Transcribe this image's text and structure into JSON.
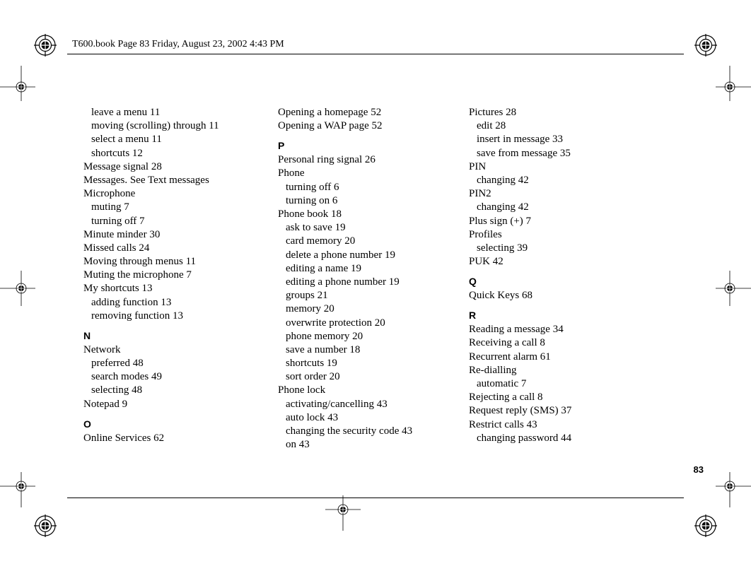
{
  "header": "T600.book  Page 83  Friday, August 23, 2002  4:43 PM",
  "page_number": "83",
  "col1": [
    {
      "t": "sub",
      "text": "leave a menu 11"
    },
    {
      "t": "sub",
      "text": "moving (scrolling) through 11"
    },
    {
      "t": "sub",
      "text": "select a menu 11"
    },
    {
      "t": "sub",
      "text": "shortcuts 12"
    },
    {
      "t": "entry",
      "text": "Message signal 28"
    },
    {
      "t": "entry",
      "text": "Messages. See Text messages"
    },
    {
      "t": "entry",
      "text": "Microphone"
    },
    {
      "t": "sub",
      "text": "muting 7"
    },
    {
      "t": "sub",
      "text": "turning off 7"
    },
    {
      "t": "entry",
      "text": "Minute minder 30"
    },
    {
      "t": "entry",
      "text": "Missed calls 24"
    },
    {
      "t": "entry",
      "text": "Moving through menus 11"
    },
    {
      "t": "entry",
      "text": "Muting the microphone 7"
    },
    {
      "t": "entry",
      "text": "My shortcuts 13"
    },
    {
      "t": "sub",
      "text": "adding function 13"
    },
    {
      "t": "sub",
      "text": "removing function 13"
    },
    {
      "t": "letter",
      "text": "N"
    },
    {
      "t": "entry",
      "text": "Network"
    },
    {
      "t": "sub",
      "text": "preferred 48"
    },
    {
      "t": "sub",
      "text": "search modes 49"
    },
    {
      "t": "sub",
      "text": "selecting 48"
    },
    {
      "t": "entry",
      "text": "Notepad 9"
    },
    {
      "t": "letter",
      "text": "O"
    },
    {
      "t": "entry",
      "text": "Online Services 62"
    }
  ],
  "col2": [
    {
      "t": "entry",
      "text": "Opening a homepage 52"
    },
    {
      "t": "entry",
      "text": "Opening a WAP page 52"
    },
    {
      "t": "letter",
      "text": "P"
    },
    {
      "t": "entry",
      "text": "Personal ring signal 26"
    },
    {
      "t": "entry",
      "text": "Phone"
    },
    {
      "t": "sub",
      "text": "turning off 6"
    },
    {
      "t": "sub",
      "text": "turning on 6"
    },
    {
      "t": "entry",
      "text": "Phone book 18"
    },
    {
      "t": "sub",
      "text": "ask to save 19"
    },
    {
      "t": "sub",
      "text": "card memory 20"
    },
    {
      "t": "sub",
      "text": "delete a phone number 19"
    },
    {
      "t": "sub",
      "text": "editing a name 19"
    },
    {
      "t": "sub",
      "text": "editing a phone number 19"
    },
    {
      "t": "sub",
      "text": "groups 21"
    },
    {
      "t": "sub",
      "text": "memory 20"
    },
    {
      "t": "sub",
      "text": "overwrite protection 20"
    },
    {
      "t": "sub",
      "text": "phone memory 20"
    },
    {
      "t": "sub",
      "text": "save a number 18"
    },
    {
      "t": "sub",
      "text": "shortcuts 19"
    },
    {
      "t": "sub",
      "text": "sort order 20"
    },
    {
      "t": "entry",
      "text": "Phone lock"
    },
    {
      "t": "sub",
      "text": "activating/cancelling 43"
    },
    {
      "t": "sub",
      "text": "auto lock 43"
    },
    {
      "t": "sub",
      "text": "changing the security code 43"
    },
    {
      "t": "sub",
      "text": "on 43"
    }
  ],
  "col3": [
    {
      "t": "entry",
      "text": "Pictures 28"
    },
    {
      "t": "sub",
      "text": "edit 28"
    },
    {
      "t": "sub",
      "text": "insert in message 33"
    },
    {
      "t": "sub",
      "text": "save from message 35"
    },
    {
      "t": "entry",
      "text": "PIN"
    },
    {
      "t": "sub",
      "text": "changing 42"
    },
    {
      "t": "entry",
      "text": "PIN2"
    },
    {
      "t": "sub",
      "text": "changing 42"
    },
    {
      "t": "entry",
      "text": "Plus sign (+) 7"
    },
    {
      "t": "entry",
      "text": "Profiles"
    },
    {
      "t": "sub",
      "text": "selecting 39"
    },
    {
      "t": "entry",
      "text": "PUK 42"
    },
    {
      "t": "letter",
      "text": "Q"
    },
    {
      "t": "entry",
      "text": "Quick Keys 68"
    },
    {
      "t": "letter",
      "text": "R"
    },
    {
      "t": "entry",
      "text": "Reading a message 34"
    },
    {
      "t": "entry",
      "text": "Receiving a call 8"
    },
    {
      "t": "entry",
      "text": "Recurrent alarm 61"
    },
    {
      "t": "entry",
      "text": "Re-dialling"
    },
    {
      "t": "sub",
      "text": "automatic 7"
    },
    {
      "t": "entry",
      "text": "Rejecting a call 8"
    },
    {
      "t": "entry",
      "text": "Request reply (SMS) 37"
    },
    {
      "t": "entry",
      "text": "Restrict calls 43"
    },
    {
      "t": "sub",
      "text": "changing password 44"
    }
  ]
}
